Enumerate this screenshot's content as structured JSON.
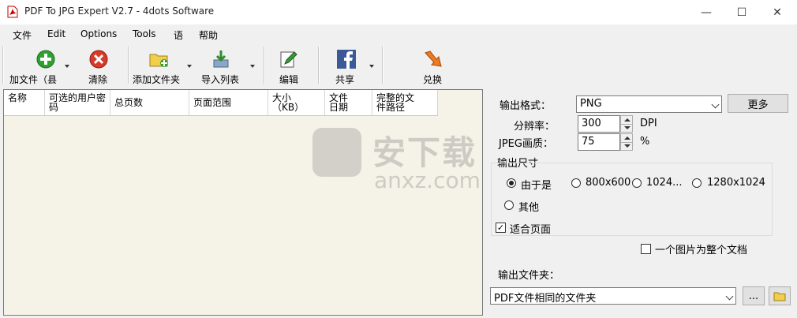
{
  "window": {
    "title": "PDF To JPG Expert V2.7 - 4dots Software",
    "minimize": "—",
    "maximize": "☐",
    "close": "✕"
  },
  "menu": [
    "文件",
    "Edit",
    "Options",
    "Tools",
    "语",
    "帮助"
  ],
  "toolbar": {
    "add_file": "加文件（县",
    "clear": "清除",
    "add_folder": "添加文件夹",
    "import_list": "导入列表",
    "edit": "编辑",
    "share": "共享",
    "convert": "兑换"
  },
  "list": {
    "columns": [
      "名称",
      "可选的用户密码",
      "总页数",
      "页面范围",
      "大小（KB）",
      "文件日期",
      "完整的文件路径"
    ]
  },
  "watermark": {
    "text": "安下载",
    "url": "anxz.com"
  },
  "settings": {
    "output_format_label": "输出格式：",
    "output_format_value": "PNG",
    "more_button": "更多",
    "resolution_label": "分辨率：",
    "resolution_value": "300",
    "resolution_unit": "DPI",
    "jpeg_quality_label": "JPEG画质：",
    "jpeg_quality_value": "75",
    "jpeg_quality_unit": "%",
    "output_size_label": "输出尺寸",
    "size_options": [
      "由于是",
      "800x600",
      "1024...",
      "1280x1024",
      "其他"
    ],
    "selected_size": "由于是",
    "fit_page_label": "适合页面",
    "fit_page_checked": true,
    "one_image_label": "一个图片为整个文档",
    "one_image_checked": false,
    "output_folder_label": "输出文件夹：",
    "output_folder_value": "PDF文件相同的文件夹",
    "browse_button": "..."
  }
}
